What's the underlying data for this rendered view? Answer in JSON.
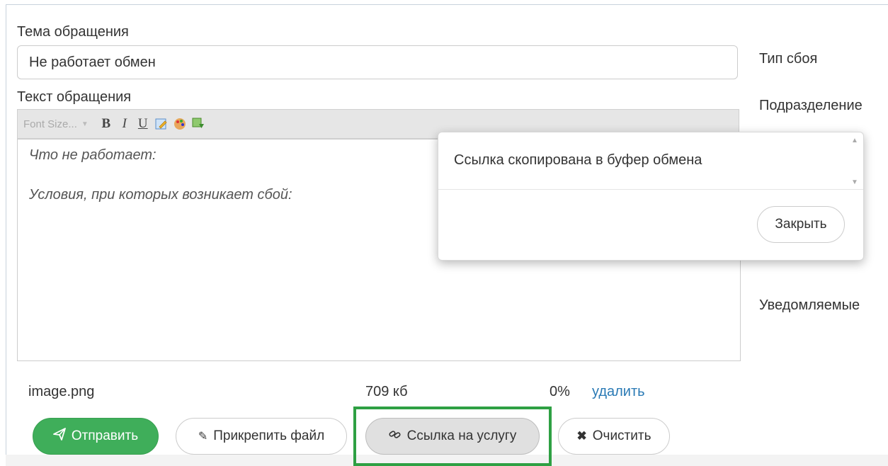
{
  "form": {
    "subject_label": "Тема обращения",
    "subject_value": "Не работает обмен",
    "text_label": "Текст обращения",
    "toolbar": {
      "font_size_placeholder": "Font Size...",
      "bold": "B",
      "italic": "I",
      "underline": "U"
    },
    "body_lines": [
      "Что не работает:",
      "Условия, при которых возникает сбой:"
    ]
  },
  "attachment": {
    "filename": "image.png",
    "size": "709 кб",
    "progress": "0%",
    "delete_label": "удалить"
  },
  "buttons": {
    "send": "Отправить",
    "attach": "Прикрепить файл",
    "service_link": "Ссылка на услугу",
    "clear": "Очистить"
  },
  "right_labels": {
    "failure_type": "Тип сбоя",
    "department": "Подразделение",
    "notified": "Уведомляемые"
  },
  "modal": {
    "message": "Ссылка скопирована в буфер обмена",
    "close": "Закрыть"
  },
  "colors": {
    "primary_green": "#3fae5a",
    "highlight_green": "#2ea043",
    "link_blue": "#2a7ab5"
  }
}
